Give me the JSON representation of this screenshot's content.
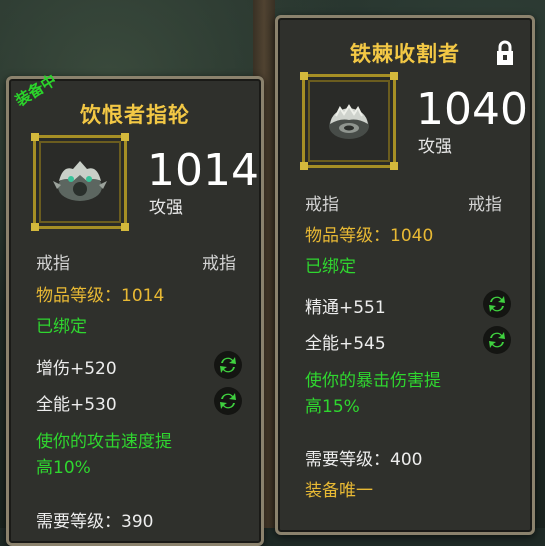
{
  "left_item": {
    "equipped_label": "装备中",
    "name": "饮恨者指轮",
    "item_level_value": "1014",
    "power_label": "攻强",
    "slot_type": "戒指",
    "slot_type_right": "戒指",
    "item_level_line": "物品等级：1014",
    "binding": "已绑定",
    "stats": [
      {
        "text": "增伤+520",
        "reforge_icon": "reforge-icon"
      },
      {
        "text": "全能+530",
        "reforge_icon": "reforge-icon"
      }
    ],
    "effect_line1": "使你的攻击速度提",
    "effect_line2": "高10%",
    "required_level": "需要等级：390"
  },
  "right_item": {
    "name": "铁棘收割者",
    "lock_icon": "lock-icon",
    "item_level_value": "1040",
    "power_label": "攻强",
    "slot_type": "戒指",
    "slot_type_right": "戒指",
    "item_level_line": "物品等级：1040",
    "binding": "已绑定",
    "stats": [
      {
        "text": "精通+551",
        "reforge_icon": "reforge-icon"
      },
      {
        "text": "全能+545",
        "reforge_icon": "reforge-icon"
      }
    ],
    "effect_line1": "使你的暴击伤害提",
    "effect_line2": "高15%",
    "required_level": "需要等级：400",
    "unique": "装备唯一"
  },
  "colors": {
    "title": "#f3c845",
    "item_level": "#e8b934",
    "green": "#2fd62f",
    "panel_border": "#8b826d"
  }
}
